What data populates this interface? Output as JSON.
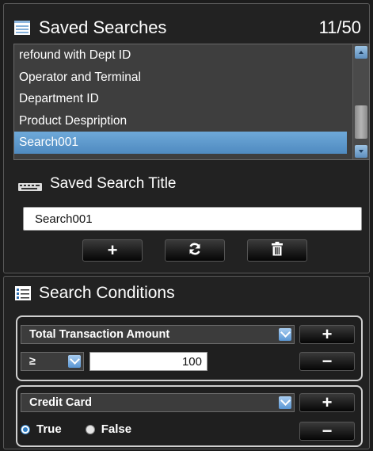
{
  "saved_searches": {
    "title": "Saved Searches",
    "count": "11/50",
    "items": [
      {
        "label": "refound with Dept ID"
      },
      {
        "label": "Operator and Terminal"
      },
      {
        "label": "Department ID"
      },
      {
        "label": "Product Despription"
      },
      {
        "label": "Search001"
      }
    ],
    "selected_label": "Search001"
  },
  "saved_search_title": {
    "label": "Saved Search Title",
    "value": "Search001"
  },
  "actions": {
    "add": "+",
    "delete": "🗑"
  },
  "search_conditions": {
    "title": "Search Conditions",
    "condition1": {
      "field": "Total Transaction Amount",
      "operator": "≥",
      "value": "100",
      "add": "+",
      "remove": "−"
    },
    "condition2": {
      "field": "Credit Card",
      "option_true": "True",
      "option_false": "False",
      "selected": "True",
      "add": "+",
      "remove": "−"
    }
  },
  "icons": {
    "list": "list-icon",
    "keyboard": "keyboard-icon",
    "conditions": "conditions-icon",
    "refresh": "refresh-icon",
    "trash": "trash-icon"
  },
  "colors": {
    "selection": "#5a96cd",
    "background": "#222222"
  }
}
